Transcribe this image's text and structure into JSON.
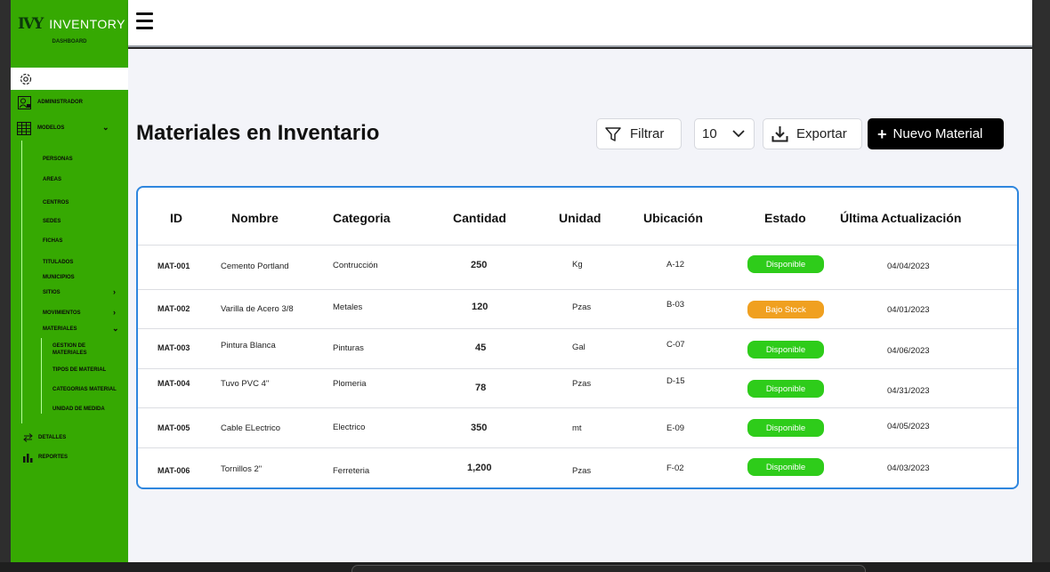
{
  "sidebar": {
    "logo": "IVY",
    "brand": "INVENTORY",
    "subtitle": "DASHBOARD",
    "items": {
      "administrador": "ADMINISTRADOR",
      "modelos": "MODELOS",
      "personas": "PERSONAS",
      "areas": "AREAS",
      "centros": "CENTROS",
      "sedes": "SEDES",
      "fichas": "FICHAS",
      "titulados": "TITULADOS",
      "municipios": "MUNICIPIOS",
      "sitios": "SITIOS",
      "movimientos": "MOVIMIENTOS",
      "materiales": "MATERIALES",
      "gestion": "GESTION DE MATERIALES",
      "tipos": "TIPOS DE MATERIAL",
      "categorias": "CATEGORIAS MATERIAL",
      "unidad": "UNIDAD DE MEDIDA",
      "detalles": "DETALLES",
      "reportes": "REPORTES"
    }
  },
  "main": {
    "title": "Materiales en Inventario",
    "filter_label": "Filtrar",
    "page_size": "10",
    "export_label": "Exportar",
    "new_label": "Nuevo Material"
  },
  "table": {
    "headers": [
      "ID",
      "Nombre",
      "Categoria",
      "Cantidad",
      "Unidad",
      "Ubicación",
      "Estado",
      "Última Actualización"
    ],
    "rows": [
      {
        "id": "MAT-001",
        "nombre": "Cemento Portland",
        "categoria": "Contrucción",
        "cantidad": "250",
        "unidad": "Kg",
        "ubicacion": "A-12",
        "estado": "Disponible",
        "fecha": "04/04/2023"
      },
      {
        "id": "MAT-002",
        "nombre": "Varilla de Acero 3/8",
        "categoria": "Metales",
        "cantidad": "120",
        "unidad": "Pzas",
        "ubicacion": "B-03",
        "estado": "Bajo Stock",
        "fecha": "04/01/2023"
      },
      {
        "id": "MAT-003",
        "nombre": "Pintura Blanca",
        "categoria": "Pinturas",
        "cantidad": "45",
        "unidad": "Gal",
        "ubicacion": "C-07",
        "estado": "Disponible",
        "fecha": "04/06/2023"
      },
      {
        "id": "MAT-004",
        "nombre": "Tuvo PVC 4\"",
        "categoria": "Plomeria",
        "cantidad": "78",
        "unidad": "Pzas",
        "ubicacion": "D-15",
        "estado": "Disponible",
        "fecha": "04/31/2023"
      },
      {
        "id": "MAT-005",
        "nombre": "Cable ELectrico",
        "categoria": "Electrico",
        "cantidad": "350",
        "unidad": "mt",
        "ubicacion": "E-09",
        "estado": "Disponible",
        "fecha": "04/05/2023"
      },
      {
        "id": "MAT-006",
        "nombre": "Tornillos 2\"",
        "categoria": "Ferreteria",
        "cantidad": "1,200",
        "unidad": "Pzas",
        "ubicacion": "F-02",
        "estado": "Disponible",
        "fecha": "04/03/2023"
      }
    ]
  },
  "colors": {
    "sidebar": "#36a902",
    "disponible": "#2ecc1a",
    "bajo_stock": "#f0a020",
    "table_border": "#2e86de"
  },
  "icons": {
    "settings": "gear-icon",
    "admin": "user-admin-icon",
    "modelos": "table-grid-icon",
    "detalles": "swap-arrows-icon",
    "reportes": "bar-chart-icon",
    "filter": "funnel-icon",
    "export": "download-icon",
    "new": "plus-icon",
    "menu": "hamburger-icon"
  }
}
